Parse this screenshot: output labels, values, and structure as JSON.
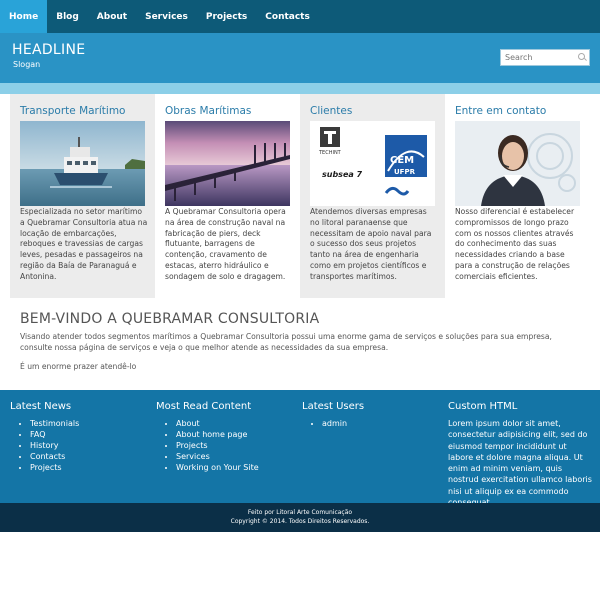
{
  "nav": {
    "items": [
      {
        "label": "Home",
        "active": true
      },
      {
        "label": "Blog"
      },
      {
        "label": "About"
      },
      {
        "label": "Services"
      },
      {
        "label": "Projects"
      },
      {
        "label": "Contacts"
      }
    ]
  },
  "header": {
    "headline": "HEADLINE",
    "slogan": "Slogan",
    "search_placeholder": "Search"
  },
  "features": [
    {
      "title": "Transporte Marítimo",
      "text": "Especializada no setor marítimo a Quebramar Consultoria atua na locação de embarcações, reboques e travessias de cargas leves, pesadas e passageiros na região da Baía de Paranaguá e Antonina."
    },
    {
      "title": "Obras Marítimas",
      "text": "A Quebramar Consultoria opera na área de construção naval na fabricação de piers, deck flutuante, barragens de contenção, cravamento de estacas, aterro hidráulico e sondagem de solo e dragagem."
    },
    {
      "title": "Clientes",
      "text": "Atendemos diversas empresas no litoral paranaense que necessitam de apoio naval para o sucesso dos seus projetos tanto na área de engenharia como em projetos científicos e transportes marítimos.",
      "logos": {
        "techint": "TECHINT",
        "cem": "CEM",
        "ufpr": "UFPR",
        "subsea": "subsea 7"
      }
    },
    {
      "title": "Entre em contato",
      "text": "Nosso diferencial é estabelecer compromissos de longo prazo com os nossos clientes através do conhecimento das suas necessidades criando a base para a construção de relações comerciais eficientes."
    }
  ],
  "welcome": {
    "title": "BEM-VINDO A QUEBRAMAR CONSULTORIA",
    "intro": "Visando atender todos segmentos marítimos a Quebramar Consultoria possui uma enorme gama de serviços e soluções para sua empresa, consulte nossa página de serviços e veja o que melhor atende as necessidades da sua empresa.",
    "thanks": "É um enorme prazer atendê-lo"
  },
  "footer": {
    "latest_news": {
      "title": "Latest News",
      "items": [
        "Testimonials",
        "FAQ",
        "History",
        "Contacts",
        "Projects"
      ]
    },
    "most_read": {
      "title": "Most Read Content",
      "items": [
        "About",
        "About home page",
        "Projects",
        "Services",
        "Working on Your Site"
      ]
    },
    "latest_users": {
      "title": "Latest Users",
      "items": [
        "admin"
      ]
    },
    "custom_html": {
      "title": "Custom HTML",
      "text": "Lorem ipsum dolor sit amet, consectetur adipisicing elit, sed do eiusmod tempor incididunt ut labore et dolore magna aliqua. Ut enim ad minim veniam, quis nostrud exercitation ullamco laboris nisi ut aliquip ex ea commodo consequat."
    }
  },
  "bottom": {
    "credit": "Feito por Litoral Arte Comunicação",
    "copyright": "Copyright © 2014. Todos Direitos Reservados."
  },
  "colors": {
    "nav_bg": "#0d5a78",
    "nav_active": "#29a3d8",
    "header_bg": "#2a93c5",
    "footer_bg": "#1475a6",
    "bottom_bg": "#0b2f47",
    "accent_title": "#2b7ca9"
  }
}
